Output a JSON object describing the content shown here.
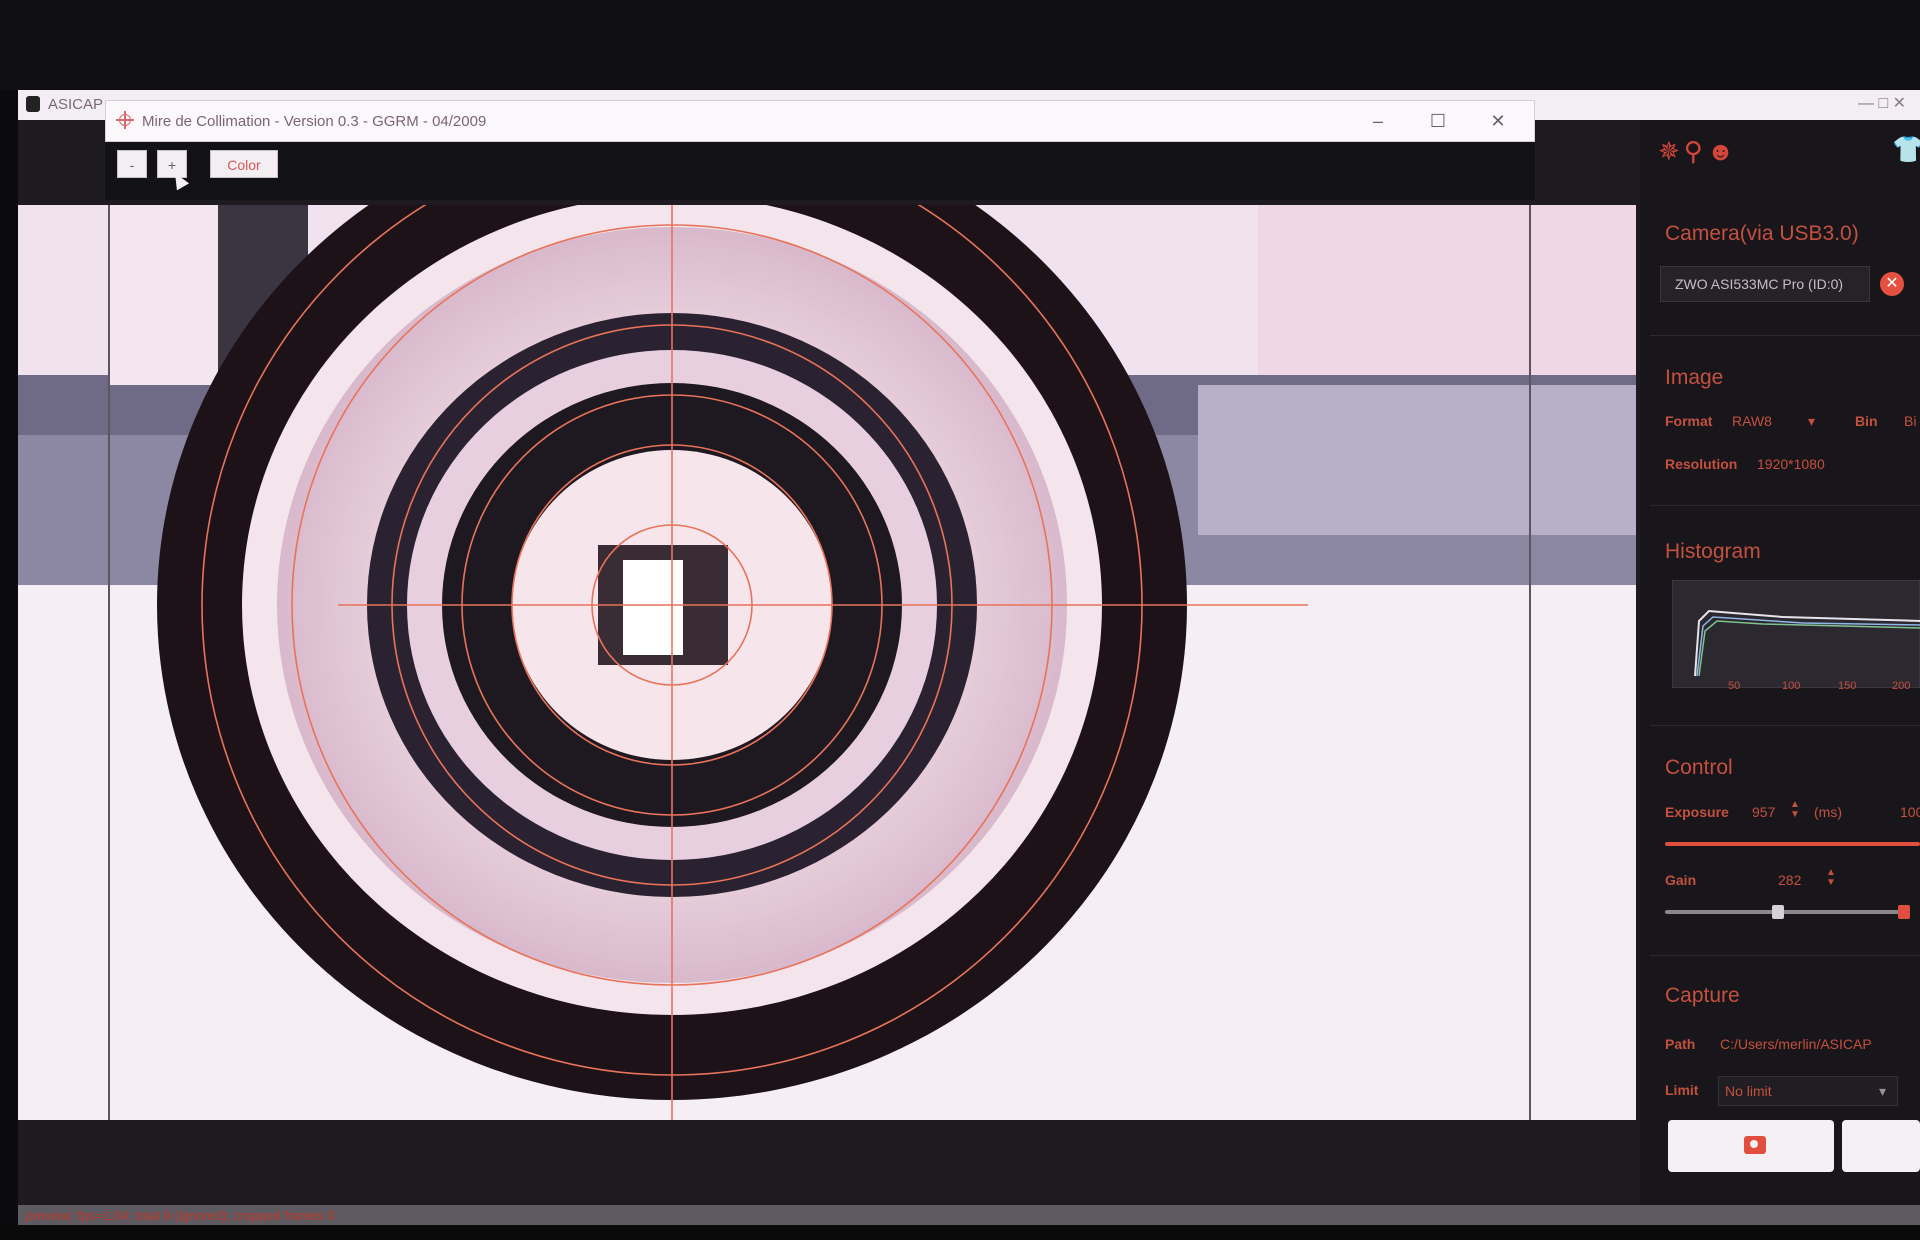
{
  "asicap": {
    "title": "ASICAP",
    "window_controls": "— □ ✕"
  },
  "mire": {
    "title": "Mire de Collimation - Version 0.3 - GGRM - 04/2009",
    "minimize": "–",
    "maximize": "☐",
    "close": "✕",
    "toolbar": {
      "minus_label": "-",
      "plus_label": "+",
      "color_label": "Color"
    }
  },
  "panel": {
    "camera_title": "Camera(via USB3.0)",
    "device_name": "ZWO ASI533MC Pro (ID:0)",
    "image_title": "Image",
    "format_label": "Format",
    "format_value": "RAW8",
    "bin_label": "Bin",
    "bin_value": "Bi",
    "resolution_label": "Resolution",
    "resolution_value": "1920*1080",
    "histogram_title": "Histogram",
    "histogram_ticks": [
      "50",
      "100",
      "150",
      "200"
    ],
    "control_title": "Control",
    "exposure_label": "Exposure",
    "exposure_value": "957",
    "exposure_unit": "(ms)",
    "exposure_max": "100",
    "gain_label": "Gain",
    "gain_value": "282",
    "capture_title": "Capture",
    "path_label": "Path",
    "path_value": "C:/Users/merlin/ASICAP",
    "limit_label": "Limit",
    "limit_value": "No limit"
  },
  "status": {
    "text": "preview: fps=1.04; total 9 (ignored); cropped frames 0"
  },
  "colors": {
    "accent": "#c4503f",
    "reticle": "#e8735a",
    "panel_bg": "#18161a"
  }
}
